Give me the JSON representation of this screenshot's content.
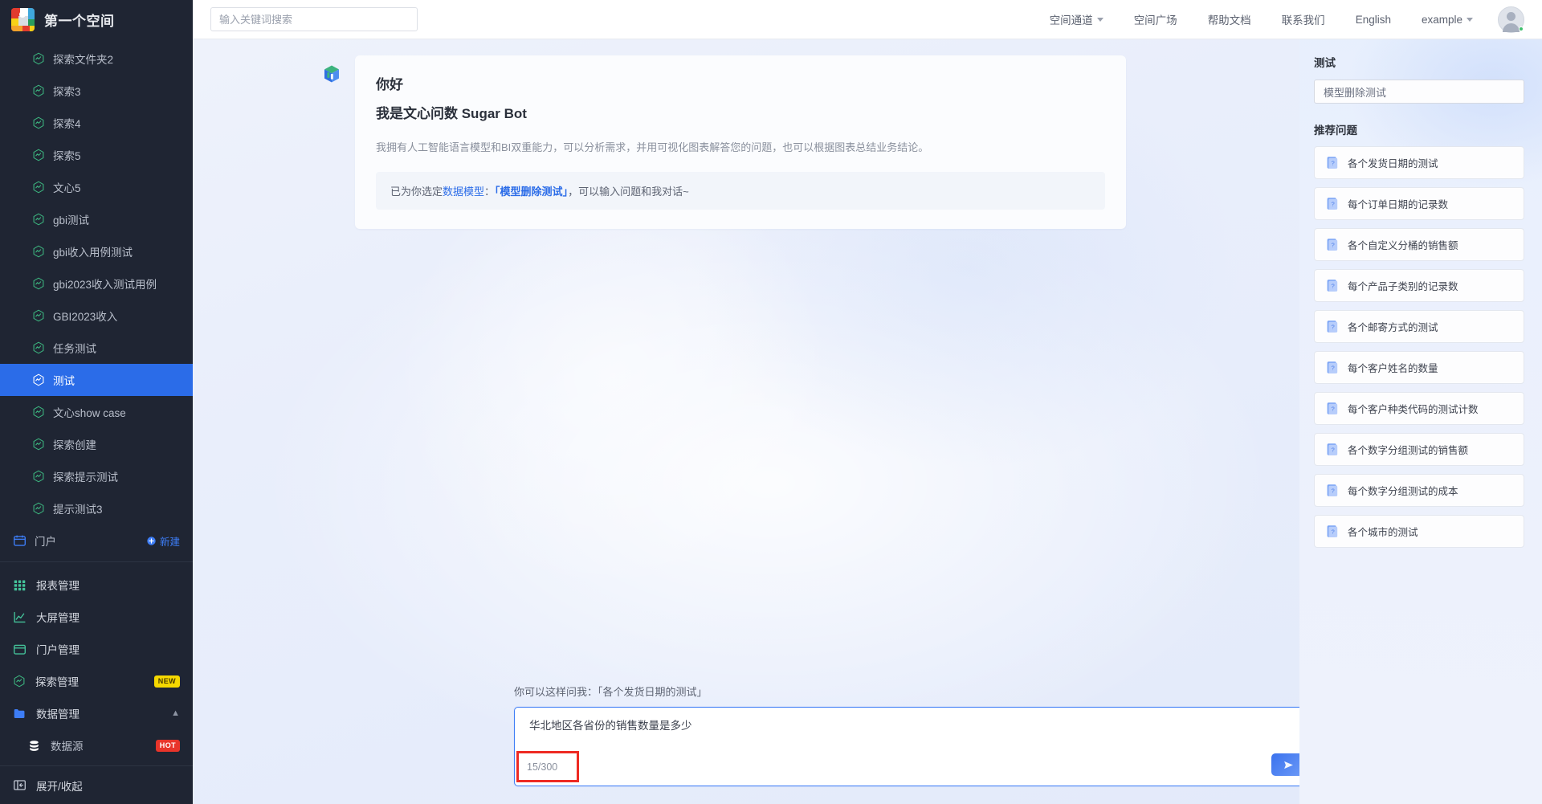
{
  "sidebar": {
    "brand": {
      "title": "第一个空间",
      "logo_icon": "app-logo"
    },
    "explore_items": [
      {
        "label": "探索文件夹2",
        "icon": "hexagon-chart-icon",
        "active": false
      },
      {
        "label": "探索3",
        "icon": "hexagon-chart-icon",
        "active": false
      },
      {
        "label": "探索4",
        "icon": "hexagon-chart-icon",
        "active": false
      },
      {
        "label": "探索5",
        "icon": "hexagon-chart-icon",
        "active": false
      },
      {
        "label": "文心5",
        "icon": "hexagon-chart-icon",
        "active": false
      },
      {
        "label": "gbi测试",
        "icon": "hexagon-chart-icon",
        "active": false
      },
      {
        "label": "gbi收入用例测试",
        "icon": "hexagon-chart-icon",
        "active": false
      },
      {
        "label": "gbi2023收入测试用例",
        "icon": "hexagon-chart-icon",
        "active": false
      },
      {
        "label": "GBI2023收入",
        "icon": "hexagon-chart-icon",
        "active": false
      },
      {
        "label": "任务测试",
        "icon": "hexagon-chart-icon",
        "active": false
      },
      {
        "label": "测试",
        "icon": "hexagon-chart-icon",
        "active": true
      },
      {
        "label": "文心show case",
        "icon": "hexagon-chart-icon",
        "active": false
      },
      {
        "label": "探索创建",
        "icon": "hexagon-chart-icon",
        "active": false
      },
      {
        "label": "探索提示测试",
        "icon": "hexagon-chart-icon",
        "active": false
      },
      {
        "label": "提示测试3",
        "icon": "hexagon-chart-icon",
        "active": false
      }
    ],
    "portal": {
      "label": "门户",
      "icon": "portal-icon",
      "new_label": "新建",
      "new_icon": "plus-circle-icon"
    },
    "nav_items": [
      {
        "label": "报表管理",
        "icon": "grid-icon",
        "badge": ""
      },
      {
        "label": "大屏管理",
        "icon": "chart-screen-icon",
        "badge": ""
      },
      {
        "label": "门户管理",
        "icon": "portal-manage-icon",
        "badge": ""
      },
      {
        "label": "探索管理",
        "icon": "hexagon-chart-icon",
        "badge": "NEW"
      },
      {
        "label": "数据管理",
        "icon": "folder-icon",
        "badge": "",
        "expanded": true
      }
    ],
    "data_sub_item": {
      "label": "数据源",
      "icon": "database-icon",
      "badge": "HOT"
    },
    "collapse": {
      "label": "展开/收起",
      "icon": "collapse-icon"
    }
  },
  "header": {
    "search": {
      "placeholder": "输入关键词搜索",
      "value": ""
    },
    "nav": [
      {
        "label": "空间通道",
        "has_caret": true
      },
      {
        "label": "空间广场",
        "has_caret": false
      },
      {
        "label": "帮助文档",
        "has_caret": false
      },
      {
        "label": "联系我们",
        "has_caret": false
      },
      {
        "label": "English",
        "has_caret": false
      },
      {
        "label": "example",
        "has_caret": true
      }
    ],
    "avatar_icon": "user-avatar"
  },
  "chat": {
    "bot_avatar_icon": "sugar-bot-logo",
    "greeting_line1": "你好",
    "greeting_line2": "我是文心问数 Sugar Bot",
    "description": "我拥有人工智能语言模型和BI双重能力，可以分析需求，并用可视化图表解答您的问题，也可以根据图表总结业务结论。",
    "model_banner": {
      "prefix": "已为你选定",
      "link": "数据模型",
      "colon": "：",
      "model": "「模型删除测试」",
      "suffix": "，可以输入问题和我对话~"
    }
  },
  "composer": {
    "hint": "你可以这样问我：「各个发货日期的测试」",
    "value": "华北地区各省份的销售数量是多少",
    "placeholder": "",
    "counter": "15/300",
    "counter_highlight_color": "#ee2a23",
    "send_icon": "send-arrow-icon"
  },
  "right_panel": {
    "title": "测试",
    "model_name": "模型删除测试",
    "section_title": "推荐问题",
    "questions": [
      {
        "label": "各个发货日期的测试",
        "icon": "question-card-icon"
      },
      {
        "label": "每个订单日期的记录数",
        "icon": "question-card-icon"
      },
      {
        "label": "各个自定义分桶的销售额",
        "icon": "question-card-icon"
      },
      {
        "label": "每个产品子类别的记录数",
        "icon": "question-card-icon"
      },
      {
        "label": "各个邮寄方式的测试",
        "icon": "question-card-icon"
      },
      {
        "label": "每个客户姓名的数量",
        "icon": "question-card-icon"
      },
      {
        "label": "每个客户种类代码的测试计数",
        "icon": "question-card-icon"
      },
      {
        "label": "各个数字分组测试的销售额",
        "icon": "question-card-icon"
      },
      {
        "label": "每个数字分组测试的成本",
        "icon": "question-card-icon"
      },
      {
        "label": "各个城市的测试",
        "icon": "question-card-icon"
      }
    ]
  },
  "colors": {
    "sidebar_bg": "#1f2533",
    "accent_blue": "#2b6ce8",
    "active_item": "#2b6ce8",
    "hex_icon_green": "#3cb37e",
    "badge_new": "#f5d800",
    "badge_hot": "#e8342a",
    "annotation_red": "#ee2a23"
  }
}
